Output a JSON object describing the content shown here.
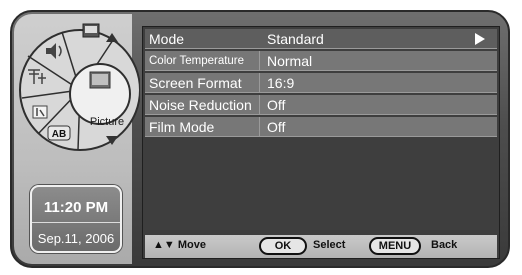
{
  "nav": {
    "current_label": "Picture",
    "icons": [
      "tv-screen-icon",
      "speaker-icon",
      "antenna-icon",
      "picture-icon",
      "time-icon",
      "ab-icon"
    ],
    "ab_label": "AB"
  },
  "clock": {
    "time": "11:20 PM",
    "date": "Sep.11, 2006"
  },
  "menu": {
    "rows": [
      {
        "label": "Mode",
        "value": "Standard"
      },
      {
        "label": "Color Temperature",
        "value": "Normal"
      },
      {
        "label": "Screen Format",
        "value": "16:9"
      },
      {
        "label": "Noise Reduction",
        "value": "Off"
      },
      {
        "label": "Film Mode",
        "value": "Off"
      }
    ]
  },
  "footer": {
    "move": "▲▼ Move",
    "ok": "OK",
    "select": "Select",
    "menu": "MENU",
    "back": "Back"
  }
}
